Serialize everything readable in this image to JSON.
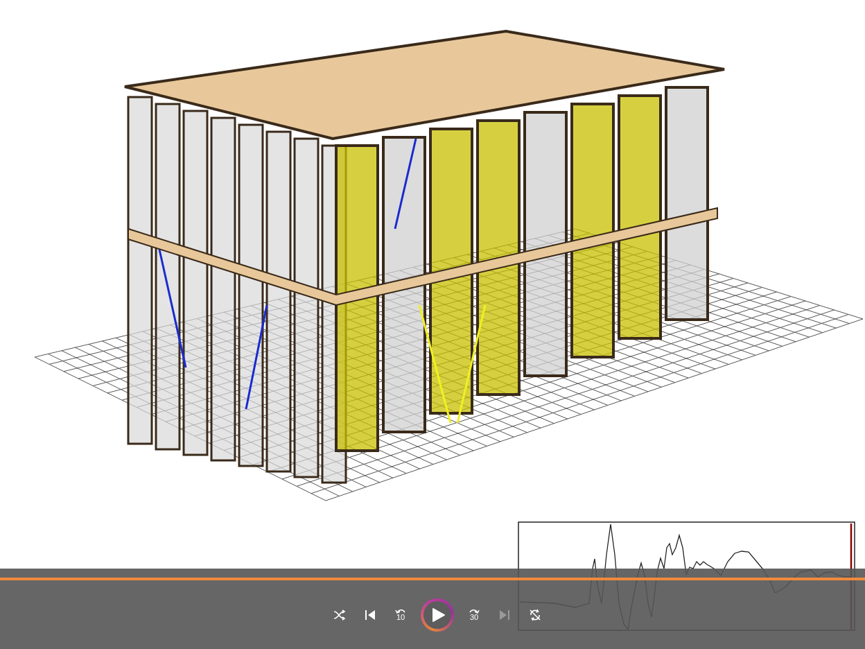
{
  "player": {
    "progress": {
      "level": 1
    },
    "controls": [
      {
        "kind": "shuffle",
        "disabled": false
      },
      {
        "kind": "previous",
        "disabled": false
      },
      {
        "kind": "rewind",
        "text": "10",
        "disabled": false
      },
      {
        "kind": "play",
        "disabled": false
      },
      {
        "kind": "forward",
        "text": "30",
        "disabled": false
      },
      {
        "kind": "next",
        "disabled": true
      },
      {
        "kind": "repeat-off",
        "disabled": false
      }
    ]
  }
}
